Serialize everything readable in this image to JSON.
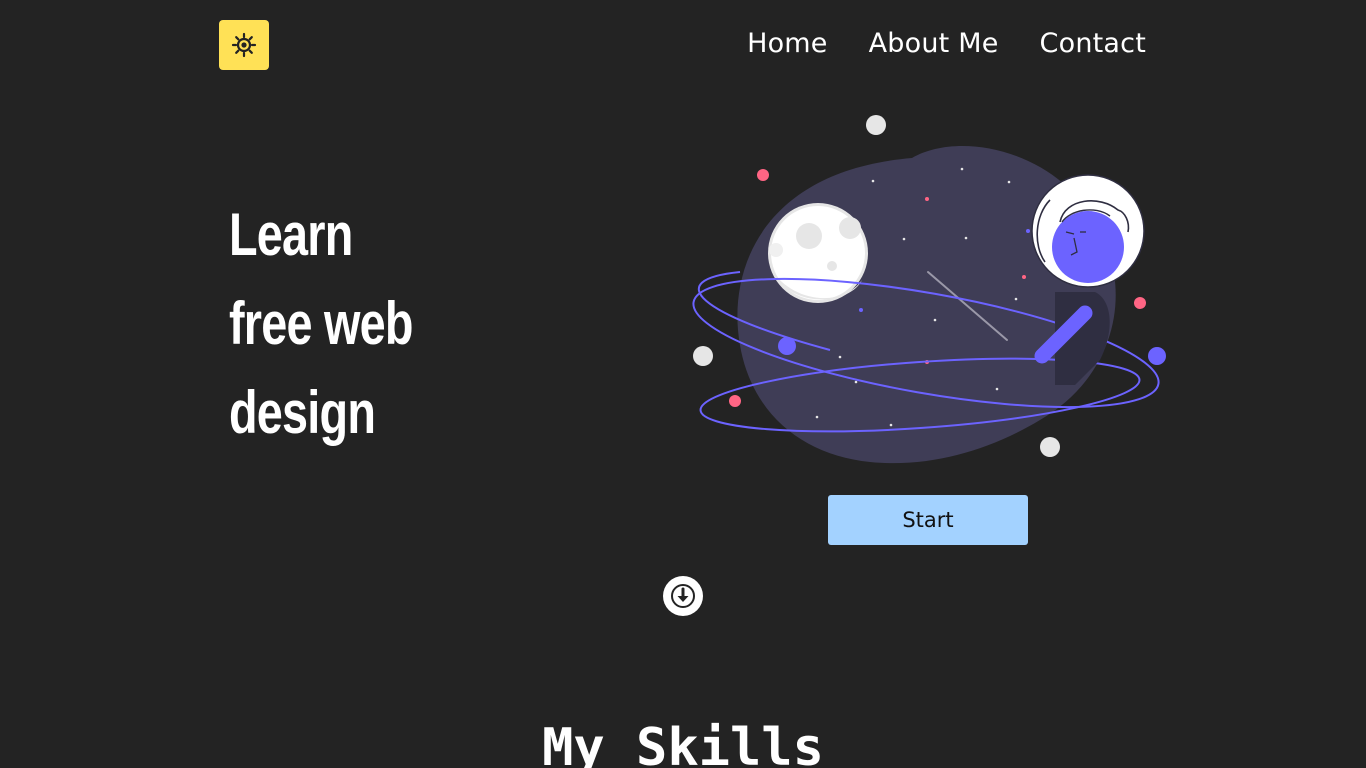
{
  "header": {
    "theme_toggle_icon": "sun-icon",
    "nav": {
      "home": "Home",
      "about": "About Me",
      "contact": "Contact"
    }
  },
  "hero": {
    "title_lines": [
      "Learn",
      "free web",
      "design"
    ],
    "illustration": "astronaut-planet-illustration",
    "start_button": "Start",
    "scroll_icon": "arrow-down-icon"
  },
  "skills": {
    "title": "My Skills"
  },
  "colors": {
    "background": "#232323",
    "toggle": "#ffe156",
    "button": "#a3d2ff",
    "planet": "#3f3d56",
    "accent": "#6c63ff",
    "pink": "#ff6584"
  }
}
